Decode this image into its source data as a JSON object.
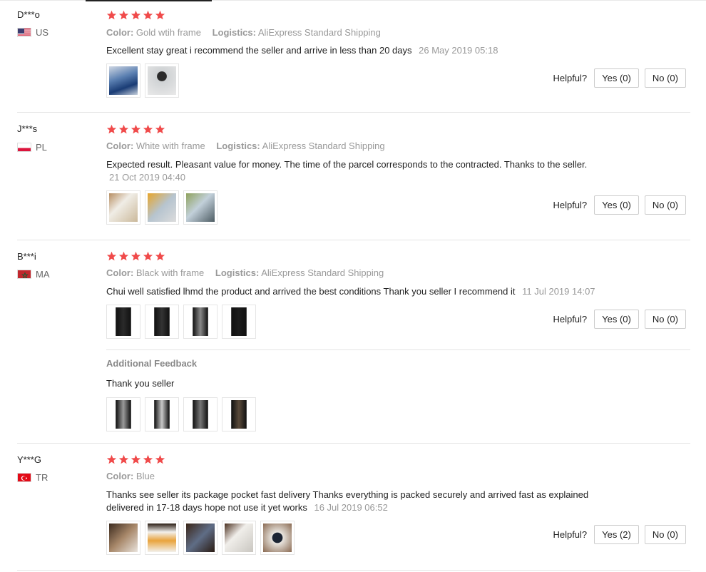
{
  "helpful_label": "Helpful?",
  "additional_feedback_title": "Additional Feedback",
  "reviews": [
    {
      "user": "D***o",
      "country": "US",
      "rating": 5,
      "color_label": "Color:",
      "color_value": "Gold wtih frame",
      "logistics_label": "Logistics:",
      "logistics_value": "AliExpress Standard Shipping",
      "text": "Excellent stay great i recommend the seller and arrive in less than 20 days",
      "date": "26 May 2019 05:18",
      "photos": [
        "photo-1",
        "photo-2"
      ],
      "yes": "Yes (0)",
      "no": "No (0)"
    },
    {
      "user": "J***s",
      "country": "PL",
      "rating": 5,
      "color_label": "Color:",
      "color_value": "White with frame",
      "logistics_label": "Logistics:",
      "logistics_value": "AliExpress Standard Shipping",
      "text": "Expected result. Pleasant value for money. The time of the parcel corresponds to the contracted. Thanks to the seller.",
      "date": "21 Oct 2019 04:40",
      "photos": [
        "photo-1",
        "photo-2",
        "photo-3"
      ],
      "yes": "Yes (0)",
      "no": "No (0)"
    },
    {
      "user": "B***i",
      "country": "MA",
      "rating": 5,
      "color_label": "Color:",
      "color_value": "Black with frame",
      "logistics_label": "Logistics:",
      "logistics_value": "AliExpress Standard Shipping",
      "text": "Chui well satisfied lhmd the product and arrived the best conditions Thank you seller I recommend it",
      "date": "11 Jul 2019 14:07",
      "photos": [
        "photo-1",
        "photo-2",
        "photo-3",
        "photo-4"
      ],
      "yes": "Yes (0)",
      "no": "No (0)",
      "additional_text": "Thank you seller",
      "additional_photos": [
        "photo-1",
        "photo-2",
        "photo-3",
        "photo-4"
      ]
    },
    {
      "user": "Y***G",
      "country": "TR",
      "rating": 5,
      "color_label": "Color:",
      "color_value": "Blue",
      "text_line1": "Thanks see seller its package pocket fast delivery Thanks everything is packed securely and arrived fast as explained",
      "text_line2": "delivered in 17-18 days hope not use it yet works",
      "date": "16 Jul 2019 06:52",
      "photos": [
        "photo-1",
        "photo-2",
        "photo-3",
        "photo-4",
        "photo-5"
      ],
      "yes": "Yes (2)",
      "no": "No (0)"
    }
  ],
  "colors": {
    "star": "#f04a4a",
    "muted": "#999999",
    "border": "#e5e5e5"
  }
}
